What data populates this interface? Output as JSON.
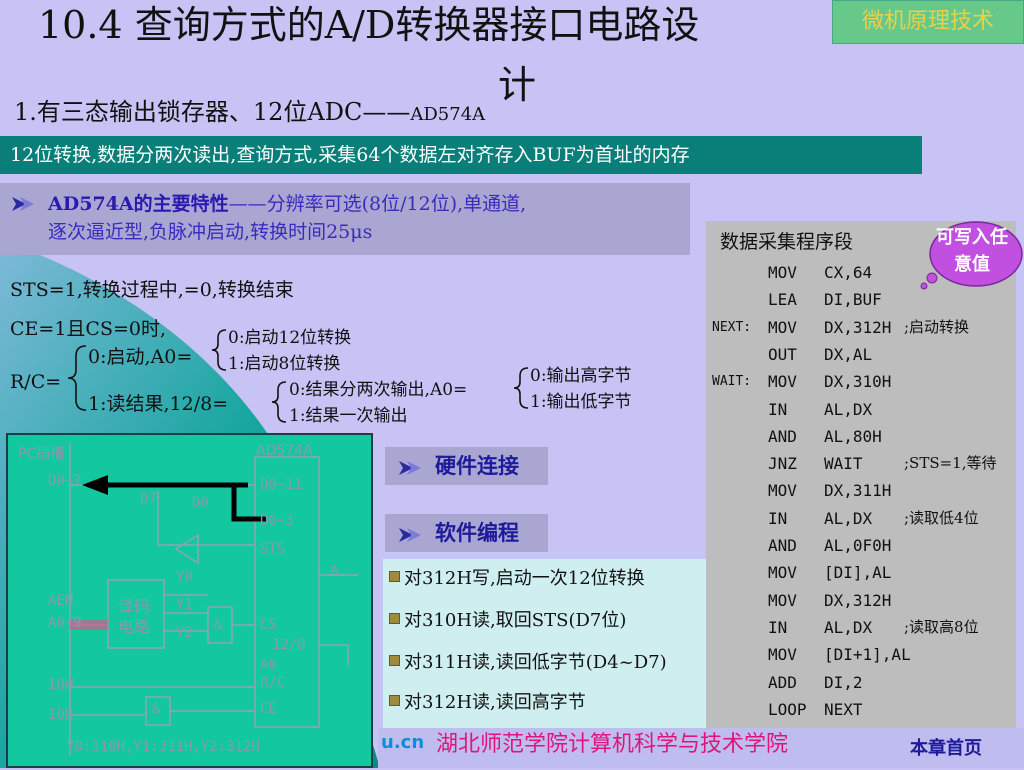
{
  "title": {
    "main": "10.4 查询方式的A/D转换器接口电路设",
    "continued": "计",
    "badge": "微机原理技术"
  },
  "subtitle": {
    "main": "1.有三态输出锁存器、12位ADC——",
    "chip": "AD574A"
  },
  "task_bar": "12位转换,数据分两次读出,查询方式,采集64个数据左对齐存入BUF为首址的内存",
  "features": {
    "label": "AD574A的主要特性",
    "line1_rest": "——分辨率可选(8位/12位),单通道,",
    "line2": "逐次逼近型,负脉冲启动,转换时间25μs"
  },
  "notes": {
    "sts": "STS=1,转换过程中,=0,转换结束",
    "ce": "CE=1且CS=0时,",
    "rc": "R/C=",
    "rc0": "0:启动,A0=",
    "rc1": "1:读结果,12/8=",
    "a0_0": "0:启动12位转换",
    "a0_1": "1:启动8位转换",
    "mode0": "0:结果分两次输出,A0=",
    "mode1": "1:结果一次输出",
    "byte0": "0:输出高字节",
    "byte1": "1:输出低字节"
  },
  "circuit": {
    "pc_slot": "PC插槽",
    "chip": "AD574A",
    "d_left": "D0~7",
    "d7": "D7",
    "d0": "D0",
    "d_right_hi": "D0~11",
    "d_right_lo": "D0~3",
    "sts": "STS",
    "aen": "AEN",
    "a_bus": "A0~9",
    "iow": "IOW",
    "ior": "IOR",
    "decoder": "译码电路",
    "y0": "Y0",
    "y1": "Y1",
    "y2": "Y2",
    "and": "&",
    "cs": "CS",
    "sel": "12/8",
    "a0": "A0",
    "rc": "R/C",
    "ce": "CE",
    "ain": "A",
    "bottom": "Y0:310H,Y1:311H,Y2:312H"
  },
  "buttons": {
    "hardware": "硬件连接",
    "software": "软件编程"
  },
  "ops": [
    "对312H写,启动一次12位转换",
    "对310H读,取回STS(D7位)",
    "对311H读,读回低字节(D4~D7)",
    "对312H读,读回高字节"
  ],
  "code": {
    "title": "数据采集程序段",
    "rows": [
      {
        "label": "",
        "op": "MOV",
        "arg": "CX,64",
        "comment": ""
      },
      {
        "label": "",
        "op": "LEA",
        "arg": "DI,BUF",
        "comment": ""
      },
      {
        "label": "NEXT:",
        "op": "MOV",
        "arg": "DX,312H",
        "comment": ";启动转换"
      },
      {
        "label": "",
        "op": "OUT",
        "arg": "DX,AL",
        "comment": ""
      },
      {
        "label": "WAIT:",
        "op": "MOV",
        "arg": "DX,310H",
        "comment": ""
      },
      {
        "label": "",
        "op": "IN",
        "arg": "AL,DX",
        "comment": ""
      },
      {
        "label": "",
        "op": "AND",
        "arg": "AL,80H",
        "comment": ""
      },
      {
        "label": "",
        "op": "JNZ",
        "arg": "WAIT",
        "comment": ";STS=1,等待"
      },
      {
        "label": "",
        "op": "MOV",
        "arg": "DX,311H",
        "comment": ""
      },
      {
        "label": "",
        "op": "IN",
        "arg": "AL,DX",
        "comment": ";读取低4位"
      },
      {
        "label": "",
        "op": "AND",
        "arg": "AL,0F0H",
        "comment": ""
      },
      {
        "label": "",
        "op": "MOV",
        "arg": "[DI],AL",
        "comment": ""
      },
      {
        "label": "",
        "op": "MOV",
        "arg": "DX,312H",
        "comment": ""
      },
      {
        "label": "",
        "op": "IN",
        "arg": "AL,DX",
        "comment": ";读取高8位"
      },
      {
        "label": "",
        "op": "MOV",
        "arg": "[DI+1],AL",
        "comment": ""
      },
      {
        "label": "",
        "op": "ADD",
        "arg": "DI,2",
        "comment": ""
      },
      {
        "label": "",
        "op": "LOOP",
        "arg": "NEXT",
        "comment": ""
      }
    ]
  },
  "bubble": "可写入任意值",
  "footer": {
    "url": "u.cn",
    "school": "湖北师范学院计算机科学与技术学院",
    "home": "本章首页"
  },
  "colors": {
    "background": "#c7c3f5",
    "teal_bar": "#0a7f7a",
    "circuit": "#13c89e",
    "bubble": "#c14fe0",
    "footer_text": "#e0157a"
  }
}
